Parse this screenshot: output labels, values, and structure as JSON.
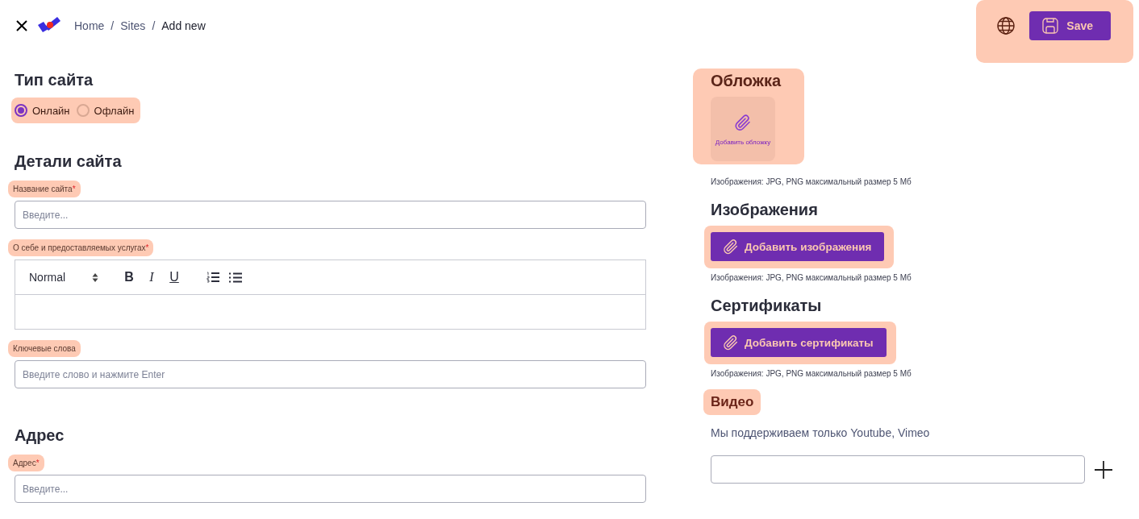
{
  "header": {
    "breadcrumbs": [
      {
        "label": "Home",
        "separator": "/",
        "current": false
      },
      {
        "label": "Sites",
        "separator": "/",
        "current": false
      },
      {
        "label": "Add new",
        "current": true
      }
    ],
    "actions": {
      "highlighted": true,
      "save": "Save"
    }
  },
  "site_type": {
    "title": "Тип сайта",
    "highlighted": true,
    "options": [
      {
        "label": "Онлайн",
        "selected": true
      },
      {
        "label": "Офлайн",
        "selected": false
      }
    ]
  },
  "details": {
    "title": "Детали сайта",
    "fields": [
      {
        "kind": "input",
        "label": "Название сайта",
        "required_mark": "*",
        "highlighted": true,
        "placeholder": "Введите..."
      },
      {
        "kind": "editor",
        "label": "О себе и предоставляемых услугах",
        "required_mark": "*",
        "highlighted": true,
        "format": "Normal",
        "buttons": [
          {
            "kind": "bold",
            "glyph": "B"
          },
          {
            "kind": "italic",
            "glyph": "I"
          },
          {
            "kind": "underline",
            "glyph": "U"
          },
          {
            "kind": "ordered-list"
          },
          {
            "kind": "bullet-list"
          }
        ]
      },
      {
        "kind": "input",
        "label": "Ключевые слова",
        "highlighted": true,
        "placeholder": "Введите слово и нажмите Enter"
      }
    ]
  },
  "address": {
    "title": "Адрес",
    "fields": [
      {
        "kind": "input",
        "label": "Адрес",
        "required_mark": "*",
        "highlighted": true,
        "placeholder": "Введите..."
      }
    ]
  },
  "cover": {
    "title": "Обложка",
    "highlighted": true,
    "upload_label": "Добавить обложку",
    "note": "Изображения: JPG, PNG максимальный размер 5 Мб"
  },
  "uploads": [
    {
      "title": "Изображения",
      "highlighted": true,
      "button": "Добавить изображения",
      "note": "Изображения: JPG, PNG максимальный размер 5 Мб"
    },
    {
      "title": "Сертификаты",
      "highlighted": true,
      "button": "Добавить сертификаты",
      "note": "Изображения: JPG, PNG максимальный размер 5 Мб"
    }
  ],
  "video": {
    "title": "Видео",
    "highlighted": true,
    "hint": "Мы поддерживаем только Youtube, Vimeo"
  }
}
